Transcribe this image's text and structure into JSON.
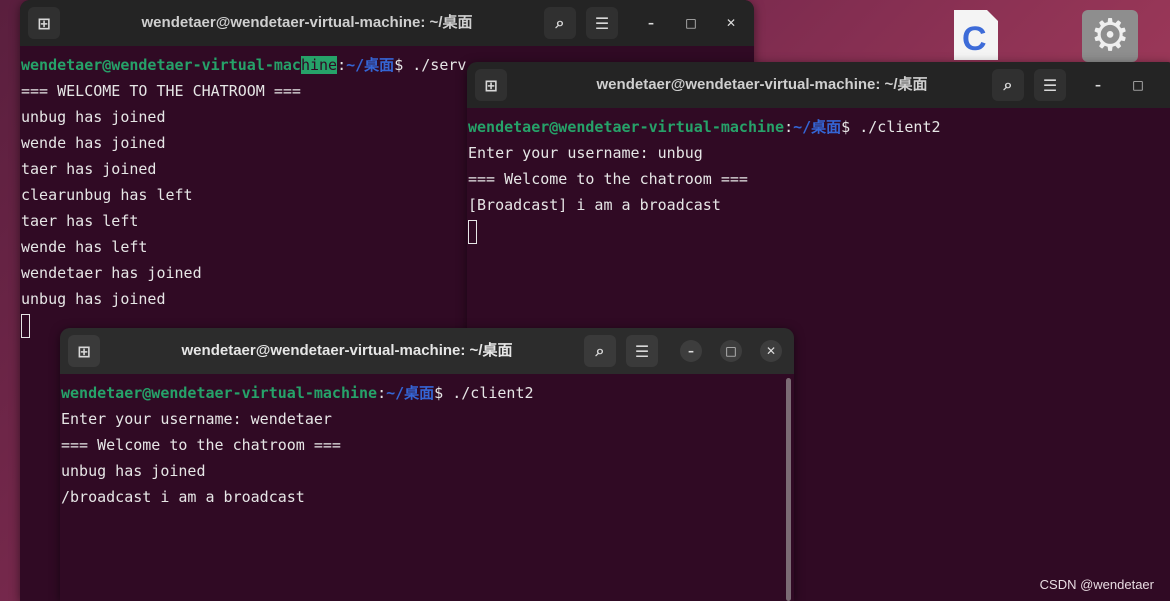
{
  "desktop": {
    "icons": [
      {
        "name": "c-source-file-icon",
        "glyph": "C",
        "color": "#3d6bd8"
      },
      {
        "name": "settings-gear-icon",
        "glyph": "⚙"
      }
    ],
    "watermark": "CSDN @wendetaer"
  },
  "prompt": {
    "user_host": "wendetaer@wendetaer-virtual-machine",
    "sep": ":",
    "path": "~/桌面",
    "dollar": "$ "
  },
  "server_window": {
    "title": "wendetaer@wendetaer-virtual-machine: ~/桌面",
    "prompt_user_a": "wendetaer@wendetaer-virtual-mac",
    "prompt_user_hl": "hine",
    "command": "./serv",
    "lines": [
      "=== WELCOME TO THE CHATROOM ===",
      "unbug has joined",
      "wende has joined",
      "taer has joined",
      "clearunbug has left",
      "taer has left",
      "wende has left",
      "wendetaer has joined",
      "unbug has joined"
    ]
  },
  "client_unbug_window": {
    "title": "wendetaer@wendetaer-virtual-machine: ~/桌面",
    "command": "./client2",
    "lines": [
      "Enter your username: unbug",
      "=== Welcome to the chatroom ===",
      "[Broadcast] i am a broadcast"
    ]
  },
  "client_wendetaer_window": {
    "title": "wendetaer@wendetaer-virtual-machine: ~/桌面",
    "command": "./client2",
    "lines": [
      "Enter your username: wendetaer",
      "=== Welcome to the chatroom ===",
      "unbug has joined",
      "/broadcast i am a broadcast"
    ]
  },
  "titlebar_icons": {
    "new_tab": "⊞",
    "search": "⌕",
    "menu": "☰",
    "minimize": "–",
    "maximize": "□",
    "close": "✕"
  },
  "colors": {
    "terminal_bg": "#300a24",
    "prompt_user": "#26a269",
    "prompt_path": "#3465d4",
    "titlebar": "#2c2c2c"
  }
}
